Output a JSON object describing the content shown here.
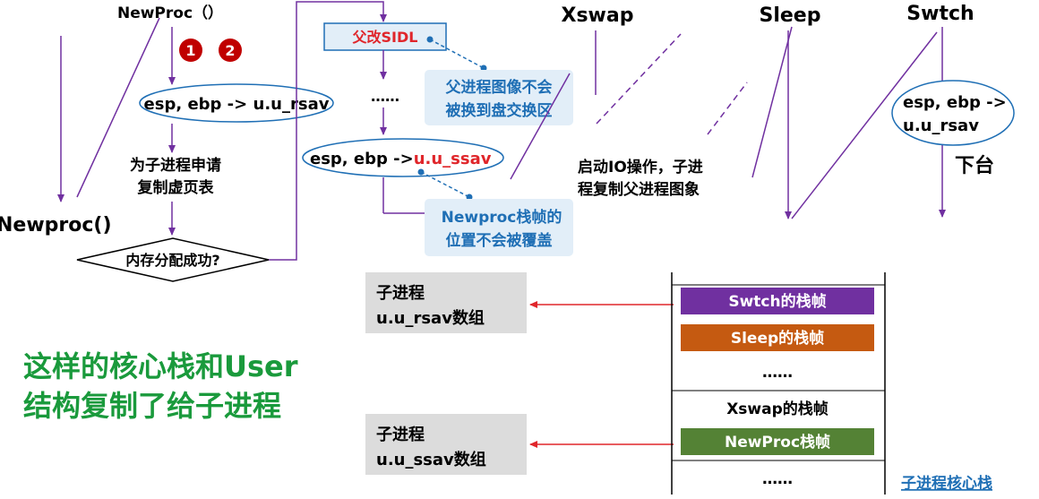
{
  "colors": {
    "line": "#7030a0",
    "red": "#e0262b",
    "blue": "#1f6fb5",
    "green": "#1a9a3c",
    "callout_bg": "#e2eef8",
    "array_bg": "#dcdcdc",
    "swtch": "#7030a0",
    "sleep": "#c55a11",
    "newproc": "#548235",
    "dashed": "#7030a0"
  },
  "newproc": {
    "title": "NewProc（）",
    "badge1": "1",
    "badge2": "2",
    "save_rsav": "esp, ebp -> u.u_rsav",
    "alloc_line1": "为子进程申请",
    "alloc_line2": "复制虚页表",
    "decision": "内存分配成功?",
    "left_label": "Newproc()"
  },
  "parent": {
    "sidl_prefix": "父改",
    "sidl_suffix": "SIDL",
    "dots": "……",
    "save_ssav_prefix": "esp, ebp ->",
    "save_ssav_suffix": "u.u_ssav"
  },
  "callouts": {
    "image_line1": "父进程图像不会",
    "image_line2": "被换到盘交换区",
    "frame_line1": "Newproc栈帧的",
    "frame_line2": "位置不会被覆盖"
  },
  "xswap": {
    "title": "Xswap",
    "note_line1": "启动IO操作，子进",
    "note_line2": "程复制父进程图象"
  },
  "sleep": {
    "title": "Sleep"
  },
  "swtch": {
    "title": "Swtch",
    "save_line1": "esp, ebp ->",
    "save_line2": "u.u_rsav",
    "off_cpu": "下台"
  },
  "arrays": {
    "rsav_line1": "子进程",
    "rsav_line2": "u.u_rsav数组",
    "ssav_line1": "子进程",
    "ssav_line2": "u.u_ssav数组"
  },
  "stack": {
    "frames": [
      "Swtch的栈帧",
      "Sleep的栈帧",
      "……",
      "Xswap的栈帧",
      "NewProc栈帧",
      "……"
    ],
    "caption": "子进程核心栈"
  },
  "summary": {
    "line1": "这样的核心栈和User",
    "line2": "结构复制了给子进程"
  }
}
